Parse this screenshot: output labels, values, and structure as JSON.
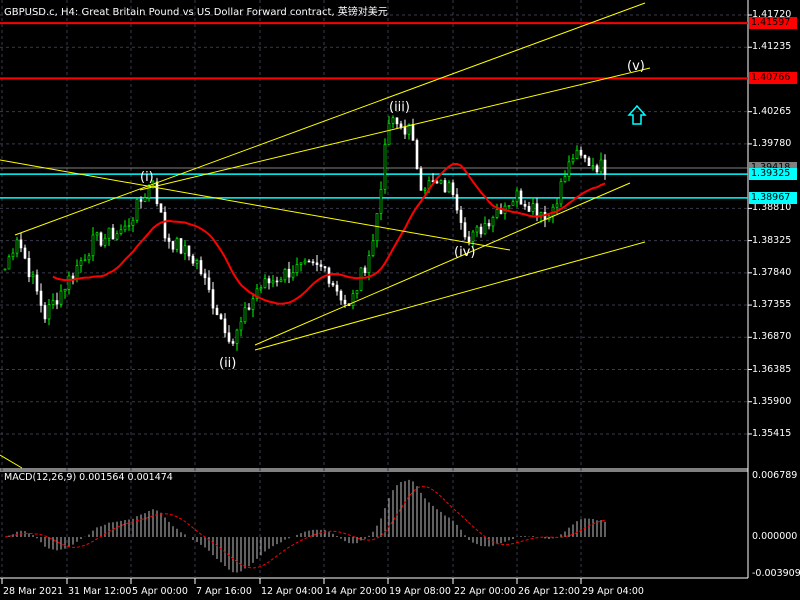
{
  "title": "GBPUSD.c, H4:  Great Britain Pound vs US Dollar Forward contract, 英镑对美元",
  "price_axis": [
    "1.41720",
    "1.41235",
    "1.40265",
    "1.39780",
    "1.38810",
    "1.38325",
    "1.37840",
    "1.37355",
    "1.36870",
    "1.36385",
    "1.35900",
    "1.35415"
  ],
  "price_labels": [
    {
      "value": "1.41597",
      "price": 1.41597,
      "bg": "#ff0000",
      "fg": "#000000",
      "kind": "red-level"
    },
    {
      "value": "1.40766",
      "price": 1.40766,
      "bg": "#ff0000",
      "fg": "#000000",
      "kind": "red-level"
    },
    {
      "value": "1.39418",
      "price": 1.39418,
      "bg": "#808080",
      "fg": "#000000",
      "kind": "bid"
    },
    {
      "value": "1.39325",
      "price": 1.39325,
      "bg": "#00ffff",
      "fg": "#000000",
      "kind": "cyan-level"
    },
    {
      "value": "1.38967",
      "price": 1.38967,
      "bg": "#00ffff",
      "fg": "#000000",
      "kind": "cyan-level"
    }
  ],
  "time_axis": [
    "28 Mar 2021",
    "31 Mar 12:00",
    "5 Apr 00:00",
    "7 Apr 16:00",
    "12 Apr 04:00",
    "14 Apr 20:00",
    "19 Apr 08:00",
    "22 Apr 00:00",
    "26 Apr 12:00",
    "29 Apr 04:00"
  ],
  "macd": {
    "label": "MACD(12,26,9) 0.001564 0.001474",
    "axis": [
      "0.006789",
      "0.000000",
      "-0.003909"
    ]
  },
  "waves": [
    "(i)",
    "(ii)",
    "(iii)",
    "(iv)",
    "(v)"
  ],
  "colors": {
    "bull": "#00ff00",
    "bear": "#ffffff",
    "ma": "#ff0000",
    "trend": "#ffff00",
    "grid": "#3a3a4a"
  },
  "chart_data": {
    "type": "candlestick",
    "symbol": "GBPUSD.c",
    "timeframe": "H4",
    "ylim": [
      1.348,
      1.419
    ],
    "waypoints": [
      [
        0,
        1.379
      ],
      [
        3,
        1.384
      ],
      [
        10,
        1.372
      ],
      [
        22,
        1.383
      ],
      [
        30,
        1.385
      ],
      [
        37,
        1.3925
      ],
      [
        40,
        1.384
      ],
      [
        48,
        1.38
      ],
      [
        52,
        1.374
      ],
      [
        57,
        1.368
      ],
      [
        63,
        1.376
      ],
      [
        72,
        1.379
      ],
      [
        80,
        1.379
      ],
      [
        86,
        1.373
      ],
      [
        92,
        1.383
      ],
      [
        96,
        1.401
      ],
      [
        101,
        1.4
      ],
      [
        104,
        1.392
      ],
      [
        112,
        1.391
      ],
      [
        116,
        1.383
      ],
      [
        123,
        1.388
      ],
      [
        128,
        1.39
      ],
      [
        136,
        1.387
      ],
      [
        142,
        1.396
      ],
      [
        150,
        1.3942
      ]
    ]
  }
}
